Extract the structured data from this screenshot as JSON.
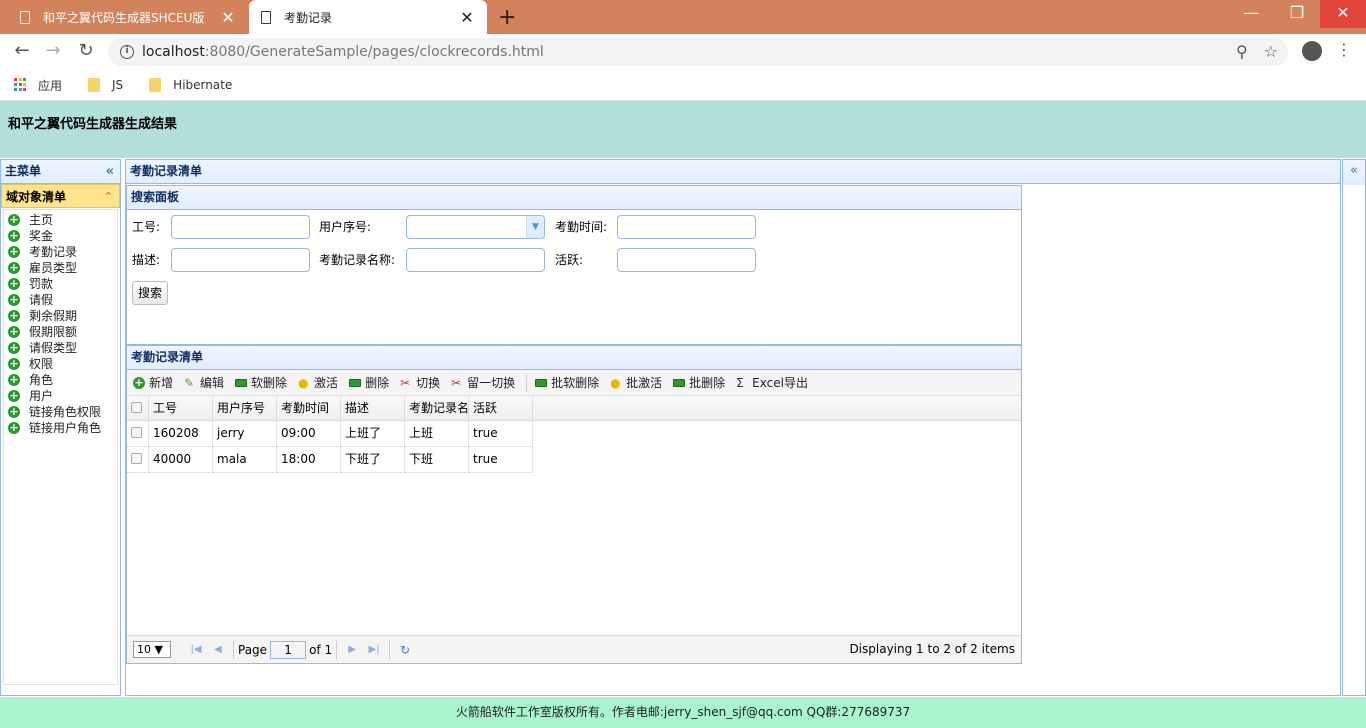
{
  "browser": {
    "tabs": [
      {
        "title": "和平之翼代码生成器SHCEU版"
      },
      {
        "title": "考勤记录"
      }
    ],
    "url_host": "localhost",
    "url_rest": ":8080/GenerateSample/pages/clockrecords.html",
    "bookmarks": [
      "应用",
      "JS",
      "Hibernate"
    ]
  },
  "header": {
    "title": "和平之翼代码生成器生成结果"
  },
  "west": {
    "title": "主菜单",
    "accordion_title": "域对象清单",
    "items": [
      "主页",
      "奖金",
      "考勤记录",
      "雇员类型",
      "罚款",
      "请假",
      "剩余假期",
      "假期限额",
      "请假类型",
      "权限",
      "角色",
      "用户",
      "链接角色权限",
      "链接用户角色"
    ]
  },
  "center": {
    "title": "考勤记录清单"
  },
  "search": {
    "title": "搜索面板",
    "labels": {
      "empid": "工号:",
      "user": "用户序号:",
      "time": "考勤时间:",
      "desc": "描述:",
      "name": "考勤记录名称:",
      "active": "活跃:"
    },
    "button": "搜索"
  },
  "grid": {
    "title": "考勤记录清单",
    "toolbar": [
      "新增",
      "编辑",
      "软删除",
      "激活",
      "删除",
      "切换",
      "留一切换",
      "批软删除",
      "批激活",
      "批删除",
      "Excel导出"
    ],
    "columns": [
      "工号",
      "用户序号",
      "考勤时间",
      "描述",
      "考勤记录名",
      "活跃"
    ],
    "rows": [
      [
        "160208",
        "jerry",
        "09:00",
        "上班了",
        "上班",
        "true"
      ],
      [
        "40000",
        "mala",
        "18:00",
        "下班了",
        "下班",
        "true"
      ]
    ]
  },
  "pager": {
    "page_size": "10",
    "page_label": "Page",
    "page": "1",
    "of_label": "of 1",
    "info": "Displaying 1 to 2 of 2 items"
  },
  "footer": {
    "text": "火箭船软件工作室版权所有。作者电邮:jerry_shen_sjf@qq.com QQ群:277689737"
  }
}
